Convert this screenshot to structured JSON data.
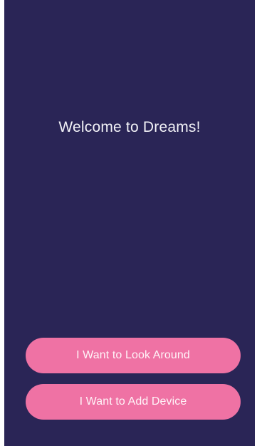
{
  "welcome": {
    "title": "Welcome to Dreams!"
  },
  "actions": {
    "look_around_label": "I Want to Look Around",
    "add_device_label": "I Want to Add Device"
  },
  "colors": {
    "background": "#2a2556",
    "button": "#ef72a4",
    "text": "#ffffff"
  }
}
